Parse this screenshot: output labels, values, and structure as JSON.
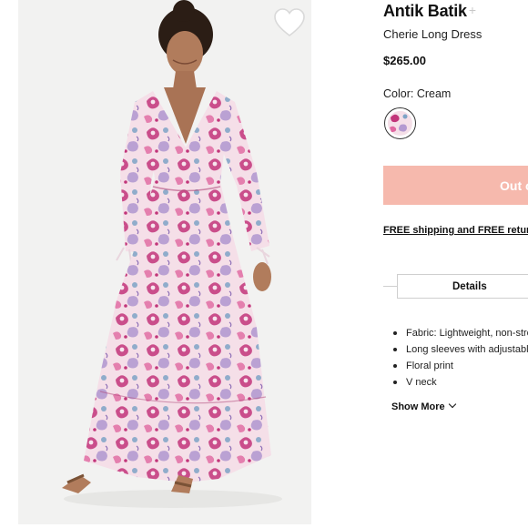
{
  "product": {
    "brand": "Antik Batik",
    "name": "Cherie Long Dress",
    "price": "$265.00",
    "color_label": "Color: Cream",
    "image_alt": "Antik Batik Cherie Long Dress",
    "swatch": {
      "color": "Cream"
    }
  },
  "cta": {
    "label": "Out of Stock",
    "shipping_text": "FREE shipping and FREE returns"
  },
  "details": {
    "tab_label": "Details",
    "features": [
      "Fabric: Lightweight, non-stretch",
      "Long sleeves with adjustable ties",
      "Floral print",
      "V neck"
    ],
    "show_more_label": "Show More"
  },
  "colors": {
    "cta_bg": "#f6b9ad",
    "image_bg": "#f2f2f1",
    "dress_base": "#f5dfe8",
    "print_magenta": "#c2357a",
    "print_blue": "#7ea3c6",
    "print_lavender": "#b49ad1"
  },
  "icons": {
    "wishlist": "heart-outline-icon",
    "brand_follow": "plus-icon",
    "show_more": "chevron-down-icon"
  }
}
